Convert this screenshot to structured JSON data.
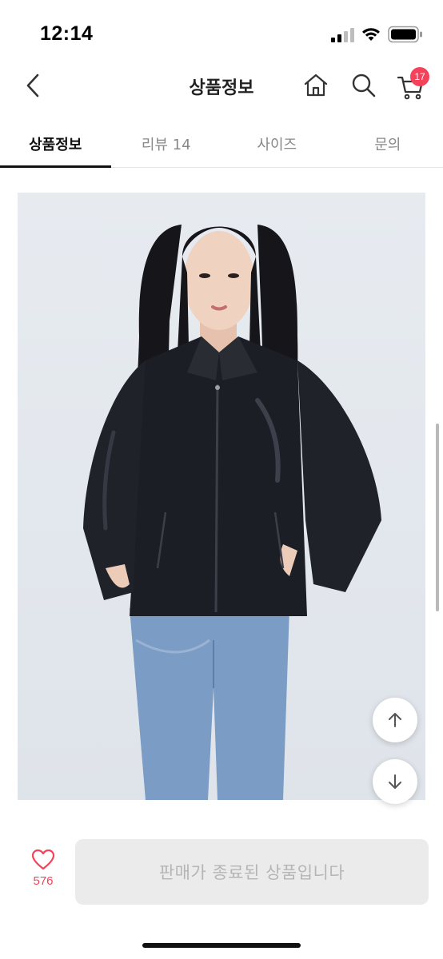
{
  "status_bar": {
    "time": "12:14"
  },
  "header": {
    "title": "상품정보",
    "cart_count": "17",
    "icons": {
      "back": "chevron-left-icon",
      "home": "home-icon",
      "search": "search-icon",
      "cart": "cart-icon"
    }
  },
  "tabs": [
    {
      "label": "상품정보",
      "active": true
    },
    {
      "label": "리뷰 14",
      "active": false
    },
    {
      "label": "사이즈",
      "active": false
    },
    {
      "label": "문의",
      "active": false
    }
  ],
  "product": {
    "image": "model-in-black-leather-jacket-and-jeans"
  },
  "bottom_bar": {
    "like_count": "576",
    "buy_label": "판매가 종료된 상품입니다"
  },
  "colors": {
    "accent": "#f4425a",
    "disabled_bg": "#ebebeb",
    "disabled_text": "#b5b5b5"
  }
}
